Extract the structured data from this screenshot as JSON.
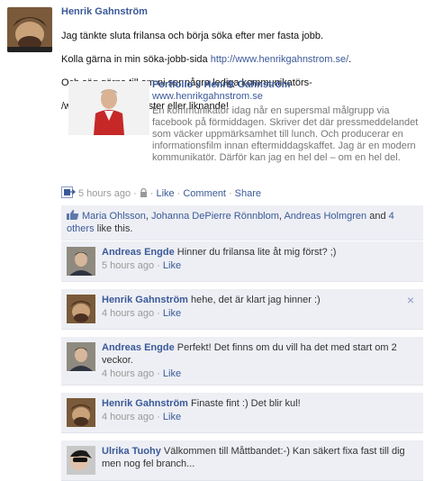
{
  "post": {
    "author": "Henrik Gahnström",
    "message_line1": "Jag tänkte sluta frilansa och börja söka efter mer fasta jobb.",
    "message_line2_pre": "Kolla gärna in min söka-jobb-sida ",
    "message_link": "http://www.henrikgahnstrom.se/",
    "message_line2_post": ".",
    "message_line3": "Och säg gärna till om ni ser några lediga kommunikatörs-",
    "message_line4": "/webbredaktörs-tjänster eller liknande!"
  },
  "attachment": {
    "title": "Portfolio » Henrik Gahnström",
    "url": "www.henrikgahnstrom.se",
    "description": "En kommunikatör idag når en supersmal målgrupp via facebook på förmiddagen. Skriver det där pressmeddelandet som väcker uppmärksamhet till lunch. Och producerar en informationsfilm innan eftermiddagskaffet. Jag är en modern kommunikatör. Därför kan jag en hel del – om en hel del."
  },
  "meta": {
    "time": "5 hours ago",
    "dash1": "·",
    "dash2": "·",
    "dash3": "·",
    "dash4": "·",
    "like": "Like",
    "comment": "Comment",
    "share": "Share"
  },
  "likes": {
    "name1": "Maria Ohlsson",
    "sep1": ", ",
    "name2": "Johanna DePierre Rönnblom",
    "sep2": ", ",
    "name3": "Andreas Holmgren",
    "and": " and ",
    "others": "4 others",
    "suffix": " like this."
  },
  "comments": [
    {
      "author": "Andreas Engde",
      "text": " Hinner du frilansa lite åt mig först? ;)",
      "time": "5 hours ago",
      "dot": " · ",
      "like": "Like"
    },
    {
      "author": "Henrik Gahnström",
      "text": " hehe, det är klart jag hinner :)",
      "time": "4 hours ago",
      "dot": " · ",
      "like": "Like",
      "close": "×"
    },
    {
      "author": "Andreas Engde",
      "text": " Perfekt! Det finns om du vill ha det med start om 2 veckor.",
      "time": "4 hours ago",
      "dot": " · ",
      "like": "Like"
    },
    {
      "author": "Henrik Gahnström",
      "text": " Finaste fint :) Det blir kul!",
      "time": "4 hours ago",
      "dot": " · ",
      "like": "Like"
    },
    {
      "author": "Ulrika Tuohy",
      "text": " Välkommen till Måttbandet:-) Kan säkert fixa fast till dig men nog fel branch...",
      "time": "",
      "dot": "",
      "like": ""
    }
  ]
}
